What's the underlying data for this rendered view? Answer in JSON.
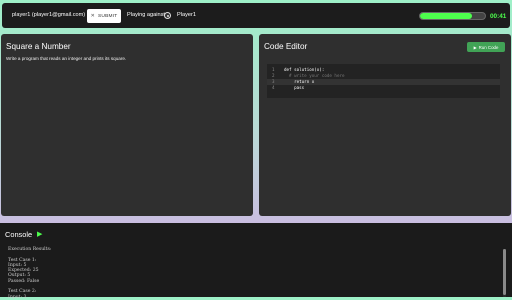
{
  "header": {
    "user_label": "player1 (player1@gmail.com)",
    "submit_label": "SUBMIT",
    "submit_icon": "x-icon",
    "playing_against_label": "Playing against",
    "opponent_name": "Player1",
    "progress_fraction": 0.8,
    "timer": "00:41"
  },
  "problem": {
    "title": "Square a Number",
    "description": "Write a program that reads an integer and prints its square."
  },
  "editor": {
    "title": "Code Editor",
    "run_label": "Run Code",
    "lines": [
      {
        "num": "1",
        "text": "def solution(x):"
      },
      {
        "num": "2",
        "text": "  # write your code here"
      },
      {
        "num": "3",
        "text": "    return x"
      },
      {
        "num": "4",
        "text": "    pass"
      }
    ]
  },
  "console": {
    "title": "Console",
    "output": "Execution Results:\n\nTest Case 1:\nInput: 5\nExpected: 25\nOutput: 5\nPassed: False\n\nTest Case 2:\nInput: 3"
  },
  "colors": {
    "accent": "#4dff4d",
    "run_button": "#41a356"
  }
}
